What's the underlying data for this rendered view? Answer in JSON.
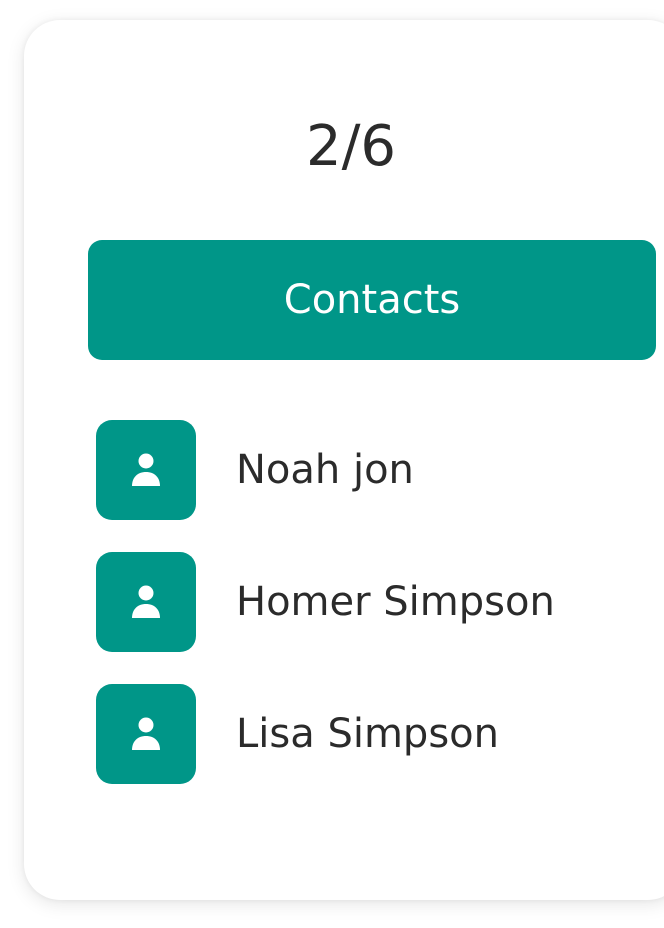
{
  "counter": "2/6",
  "contacts_button": {
    "label": "Contacts"
  },
  "contacts": [
    {
      "name": "Noah jon",
      "icon": "user-icon"
    },
    {
      "name": "Homer Simpson",
      "icon": "user-icon"
    },
    {
      "name": "Lisa Simpson",
      "icon": "user-icon"
    }
  ],
  "colors": {
    "accent": "#009688",
    "text": "#2b2b2b",
    "background": "#ffffff"
  }
}
